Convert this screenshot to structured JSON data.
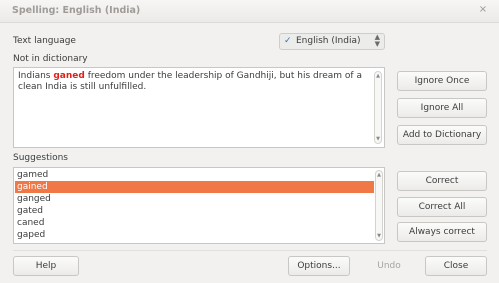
{
  "window": {
    "title": "Spelling: English (India)",
    "close_glyph": "×"
  },
  "text_language": {
    "label": "Text language",
    "value": "English (India)",
    "flag_icon": "spellcheck-flag-icon"
  },
  "not_in_dictionary": {
    "label": "Not in dictionary",
    "before": "Indians ",
    "error_word": "ganed",
    "after": " freedom under the leadership of Gandhiji, but his dream of a clean India is still unfulfilled.",
    "error_color": "#e0201b"
  },
  "side_buttons": {
    "ignore_once": "Ignore Once",
    "ignore_all": "Ignore All",
    "add_to_dictionary": "Add to Dictionary",
    "correct": "Correct",
    "correct_all": "Correct All",
    "always_correct": "Always correct"
  },
  "suggestions": {
    "label": "Suggestions",
    "items": [
      "gamed",
      "gained",
      "ganged",
      "gated",
      "caned",
      "gaped"
    ],
    "selected": "gained",
    "selection_color": "#f07746"
  },
  "footer": {
    "help": "Help",
    "options": "Options...",
    "undo": "Undo",
    "close": "Close"
  }
}
